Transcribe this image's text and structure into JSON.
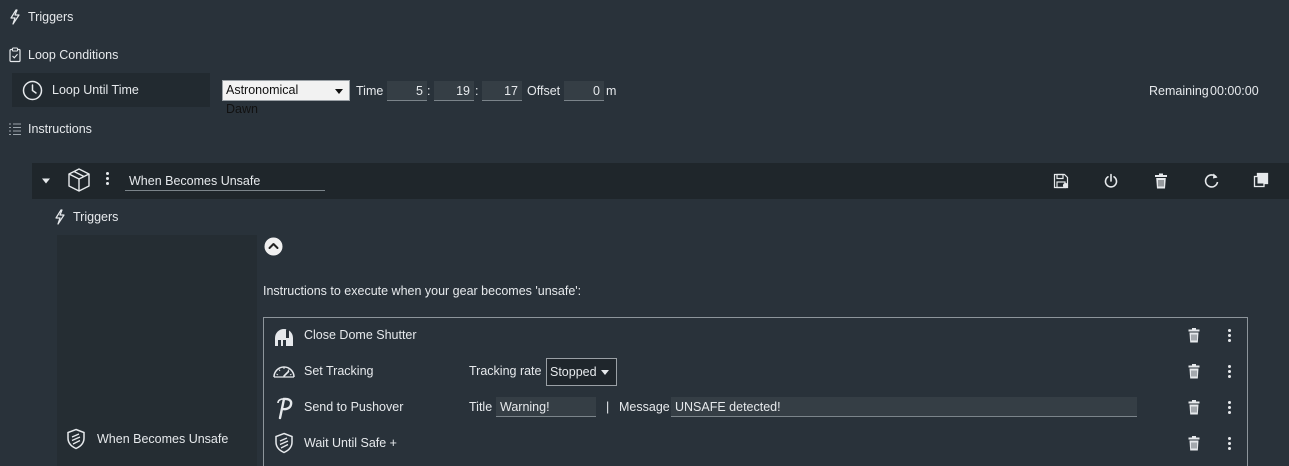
{
  "top": {
    "triggers_label": "Triggers",
    "loop_conditions_label": "Loop Conditions",
    "instructions_label": "Instructions"
  },
  "loop_condition": {
    "name": "Loop Until Time",
    "mode": "Astronomical Dawn",
    "time_label": "Time",
    "hours": "5",
    "minutes": "19",
    "seconds": "17",
    "sep": ":",
    "offset_label": "Offset",
    "offset_value": "0",
    "offset_unit": "m",
    "remaining_label": "Remaining",
    "remaining_value": "00:00:00"
  },
  "container": {
    "name": "When Becomes Unsafe",
    "triggers_label": "Triggers",
    "trigger_name": "When Becomes Unsafe",
    "description": "Instructions to execute when your gear becomes 'unsafe':"
  },
  "instructions": [
    {
      "name": "Close Dome Shutter",
      "icon": "dome-icon"
    },
    {
      "name": "Set Tracking",
      "icon": "speedometer-icon",
      "param_label": "Tracking rate",
      "param_value": "Stopped"
    },
    {
      "name": "Send to Pushover",
      "icon": "pushover-icon",
      "title_label": "Title",
      "title_value": "Warning!",
      "divider": "|",
      "message_label": "Message",
      "message_value": "UNSAFE detected!"
    },
    {
      "name": "Wait Until Safe +",
      "icon": "shield-icon"
    }
  ]
}
